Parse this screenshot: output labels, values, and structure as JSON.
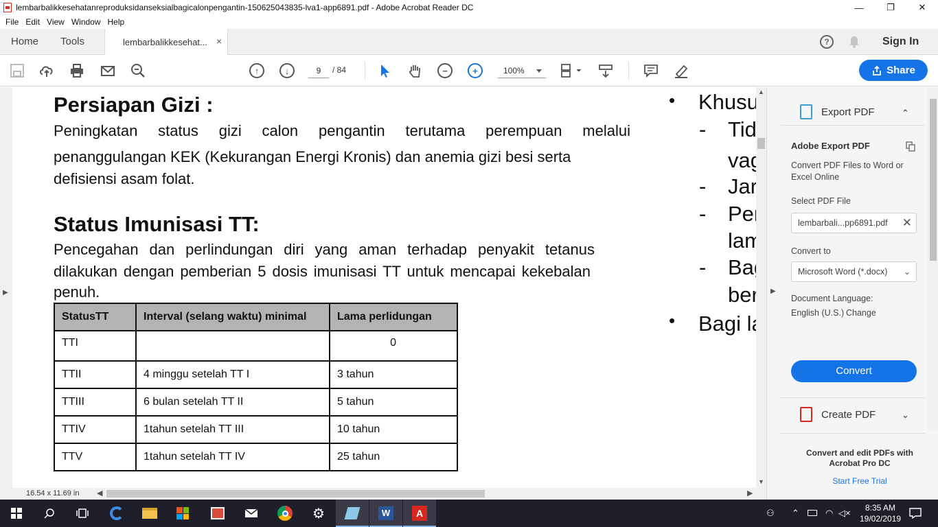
{
  "window": {
    "title": "lembarbalikkesehatanreproduksidanseksialbagicalonpengantin-150625043835-lva1-app6891.pdf - Adobe Acrobat Reader DC",
    "minimize": "—",
    "maximize": "❐",
    "close": "✕"
  },
  "menu": [
    "File",
    "Edit",
    "View",
    "Window",
    "Help"
  ],
  "tabs": {
    "home": "Home",
    "tools": "Tools",
    "document": "lembarbalikkesehat...",
    "close": "×"
  },
  "header_right": {
    "help": "?",
    "sign_in": "Sign In"
  },
  "toolbar": {
    "page_current": "9",
    "page_total": "/ 84",
    "zoom": "100%",
    "share": "Share"
  },
  "document": {
    "heading1": "Persiapan Gizi :",
    "para1_line1": "Peningkatan status gizi calon pengantin terutama perempuan melalui",
    "para1_line2": "penanggulangan KEK (Kekurangan Energi Kronis) dan anemia gizi besi serta",
    "para1_line3": "defisiensi asam folat.",
    "heading2": "Status Imunisasi TT:",
    "para2_line1": "Pencegahan dan perlindungan diri yang aman terhadap penyakit tetanus",
    "para2_line2": "dilakukan dengan pemberian 5 dosis imunisasi TT untuk mencapai kekebalan",
    "para2_line3": "penuh.",
    "table": {
      "headers": [
        "StatusTT",
        "Interval (selang waktu) minimal",
        "Lama perlidungan"
      ],
      "rows": [
        [
          "TTI",
          "",
          "0"
        ],
        [
          "TTII",
          "4 minggu setelah TT I",
          "3 tahun"
        ],
        [
          "TTIII",
          "6 bulan setelah TT II",
          "5 tahun"
        ],
        [
          "TTIV",
          "1tahun setelah TT III",
          "10 tahun"
        ],
        [
          "TTV",
          "1tahun setelah TT IV",
          "25 tahun"
        ]
      ]
    },
    "right_col": {
      "bullet": "•",
      "dash": "-",
      "l1": "Khusus",
      "l2": "Tida",
      "l3": "vag",
      "l4": "Jar",
      "l5": "Per",
      "l6": "lam",
      "l7": "Bag",
      "l8": "ber",
      "l9": "Bagi la"
    }
  },
  "statusbar": {
    "page_size": "16.54 x 11.69 in"
  },
  "right_panel": {
    "export_title": "Export PDF",
    "adobe_export": "Adobe Export PDF",
    "desc": "Convert PDF Files to Word or Excel Online",
    "select_label": "Select PDF File",
    "file_name": "lembarbali...pp6891.pdf",
    "convert_to_label": "Convert to",
    "format": "Microsoft Word (*.docx)",
    "doc_lang_label": "Document Language:",
    "doc_lang": "English (U.S.)",
    "change": "Change",
    "convert_btn": "Convert",
    "create_pdf": "Create PDF",
    "promo": "Convert and edit PDFs with Acrobat Pro DC",
    "trial": "Start Free Trial"
  },
  "taskbar": {
    "time": "8:35 AM",
    "date": "19/02/2019"
  },
  "colors": {
    "accent": "#1473e6",
    "acrobat_red": "#d6281f",
    "table_header": "#b3b3b3",
    "taskbar": "#1f1f2b"
  }
}
